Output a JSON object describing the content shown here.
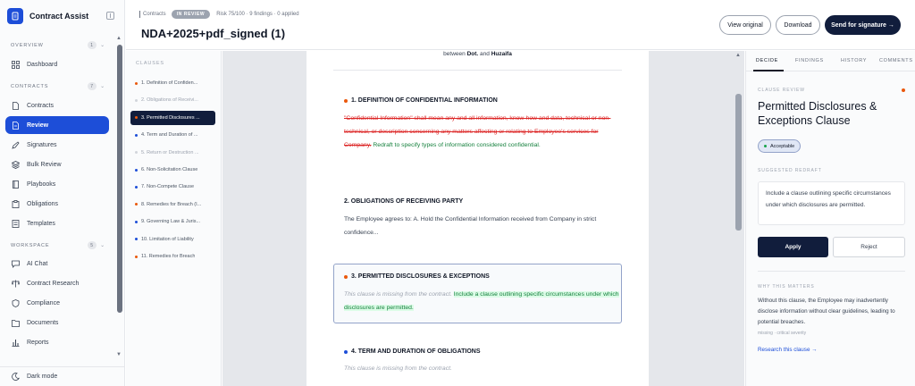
{
  "sidebar": {
    "brand": "Contract Assist",
    "sections": [
      {
        "title": "OVERVIEW",
        "count": "1"
      },
      {
        "title": "CONTRACTS",
        "count": "7"
      },
      {
        "title": "WORKSPACE",
        "count": "5"
      }
    ],
    "items": [
      {
        "label": "Dashboard",
        "icon": "dashboard-icon"
      },
      {
        "label": "Contracts",
        "icon": "file-icon"
      },
      {
        "label": "Review",
        "icon": "review-file-icon"
      },
      {
        "label": "Signatures",
        "icon": "pen-icon"
      },
      {
        "label": "Bulk Review",
        "icon": "layers-icon"
      },
      {
        "label": "Playbooks",
        "icon": "book-icon"
      },
      {
        "label": "Obligations",
        "icon": "clipboard-icon"
      },
      {
        "label": "Templates",
        "icon": "template-icon"
      },
      {
        "label": "AI Chat",
        "icon": "chat-icon"
      },
      {
        "label": "Contract Research",
        "icon": "scale-icon"
      },
      {
        "label": "Compliance",
        "icon": "shield-icon"
      },
      {
        "label": "Documents",
        "icon": "folder-icon"
      },
      {
        "label": "Reports",
        "icon": "chart-icon"
      }
    ],
    "dark_mode": "Dark mode"
  },
  "header": {
    "crumb": "Contracts",
    "status": "IN REVIEW",
    "meta": "Risk 75/100 · 9 findings · 0 applied",
    "title": "NDA+2025+pdf_signed (1)",
    "view_original": "View original",
    "download": "Download",
    "send": "Send for signature →"
  },
  "clauses": {
    "title": "CLAUSES",
    "items": [
      {
        "label": "1. Definition of Confiden...",
        "color": "#ea580c"
      },
      {
        "label": "2. Obligations of Receivi...",
        "color": "#d1d5db"
      },
      {
        "label": "3. Permitted Disclosures ...",
        "color": "#ea580c"
      },
      {
        "label": "4. Term and Duration of ...",
        "color": "#1d4ed8"
      },
      {
        "label": "5. Return or Destruction ...",
        "color": "#d1d5db"
      },
      {
        "label": "6. Non-Solicitation Clause",
        "color": "#1d4ed8"
      },
      {
        "label": "7. Non-Compete Clause",
        "color": "#1d4ed8"
      },
      {
        "label": "8. Remedies for Breach (I...",
        "color": "#ea580c"
      },
      {
        "label": "9. Governing Law & Juris...",
        "color": "#1d4ed8"
      },
      {
        "label": "10. Limitation of Liability",
        "color": "#1d4ed8"
      },
      {
        "label": "11. Remedies for Breach",
        "color": "#ea580c"
      }
    ]
  },
  "document": {
    "between_prefix": "between",
    "party_a": "Dot.",
    "and": "and",
    "party_b": "Huzaifa",
    "c1_head": "1. DEFINITION OF CONFIDENTIAL INFORMATION",
    "c1_deleted": "\"Confidential Information\" shall mean any and all information, know-how and data, technical or non-technical, or description concerning any matters affecting or relating to Employee's services for Company.",
    "c1_inserted": "Redraft to specify types of information considered confidential.",
    "c2_head": "2. OBLIGATIONS OF RECEIVING PARTY",
    "c2_body": "The Employee agrees to: A. Hold the Confidential Information received from Company in strict confidence...",
    "c3_head": "3. PERMITTED DISCLOSURES & EXCEPTIONS",
    "c3_missing": "This clause is missing from the contract.",
    "c3_inserted": "Include a clause outlining specific circumstances under which disclosures are permitted.",
    "c4_head": "4. TERM AND DURATION OF OBLIGATIONS",
    "c4_missing": "This clause is missing from the contract."
  },
  "panel": {
    "tabs": [
      "DECIDE",
      "FINDINGS",
      "HISTORY",
      "COMMENTS"
    ],
    "review_label": "CLAUSE REVIEW",
    "clause_title": "Permitted Disclosures & Exceptions Clause",
    "status_badge": "Acceptable",
    "redraft_label": "SUGGESTED REDRAFT",
    "redraft_text": "Include a clause outlining specific circumstances under which disclosures are permitted.",
    "apply": "Apply",
    "reject": "Reject",
    "why_label": "WHY THIS MATTERS",
    "why_text": "Without this clause, the Employee may inadvertently disclose information without clear guidelines, leading to potential breaches.",
    "why_meta": "missing · critical severity",
    "research_link": "Research this clause →"
  },
  "colors": {
    "accent": "#1d4ed8",
    "navy": "#111d3c",
    "risk_orange": "#ea580c",
    "insert_green": "#15803d",
    "delete_red": "#dc2626"
  }
}
